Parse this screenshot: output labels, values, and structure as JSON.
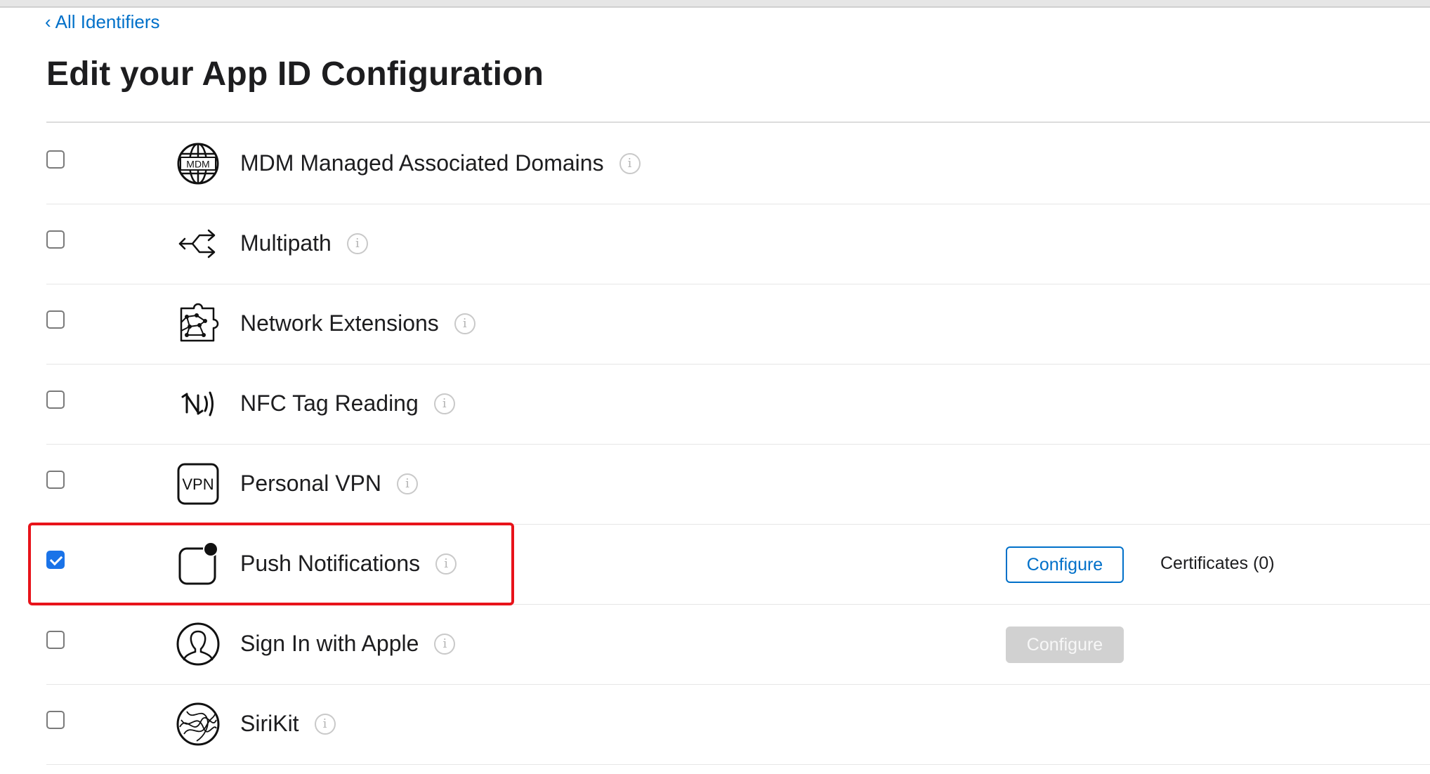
{
  "breadcrumb": {
    "chevron": "‹",
    "label": "All Identifiers"
  },
  "page": {
    "title": "Edit your App ID Configuration"
  },
  "capabilities": [
    {
      "label": "MDM Managed Associated Domains",
      "checked": false,
      "icon": "globe-mdm-icon",
      "icon_text": "MDM"
    },
    {
      "label": "Multipath",
      "checked": false,
      "icon": "multipath-arrows-icon"
    },
    {
      "label": "Network Extensions",
      "checked": false,
      "icon": "network-extensions-icon"
    },
    {
      "label": "NFC Tag Reading",
      "checked": false,
      "icon": "nfc-icon"
    },
    {
      "label": "Personal VPN",
      "checked": false,
      "icon": "vpn-icon",
      "icon_text": "VPN"
    },
    {
      "label": "Push Notifications",
      "checked": true,
      "icon": "push-notification-icon",
      "configure_label": "Configure",
      "certificates_label": "Certificates (0)"
    },
    {
      "label": "Sign In with Apple",
      "checked": false,
      "icon": "person-icon",
      "configure_label": "Configure",
      "configure_disabled": true
    },
    {
      "label": "SiriKit",
      "checked": false,
      "icon": "siri-icon"
    }
  ],
  "info_glyph": "i",
  "colors": {
    "link": "#0070c9",
    "highlight": "#e8131a",
    "checkbox_checked": "#1a73e8",
    "disabled_button": "#d1d1d1"
  }
}
